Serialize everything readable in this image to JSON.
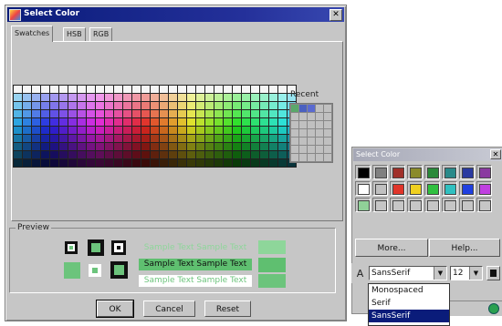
{
  "dialog": {
    "title": "Select Color",
    "close_glyph": "✕",
    "tabs": [
      "Swatches",
      "HSB",
      "RGB"
    ],
    "recent_label": "Recent",
    "recent_colors": [
      "#5aa86a",
      "#4a60c0",
      "#5a6ad0"
    ],
    "preview_label": "Preview",
    "sample_text": "Sample Text  Sample Text",
    "buttons": {
      "ok": "OK",
      "cancel": "Cancel",
      "reset": "Reset"
    }
  },
  "palette": {
    "title": "Select Color",
    "close_glyph": "✕",
    "row1": [
      "#000000",
      "#808080",
      "#a0302a",
      "#8a8a2a",
      "#2a8a3a",
      "#2a8a8a",
      "#2a3aa0",
      "#8a3aa0"
    ],
    "row2": [
      "#ffffff",
      "#c0c0c0",
      "#e0352a",
      "#f0d020",
      "#30c040",
      "#30c0c0",
      "#2040e0",
      "#c040e0"
    ],
    "row3": [
      "#90d098",
      "#c6c6c6",
      "#c6c6c6",
      "#c6c6c6",
      "#c6c6c6",
      "#c6c6c6",
      "#c6c6c6",
      "#c6c6c6"
    ],
    "more_label": "More...",
    "help_label": "Help..."
  },
  "font_bar": {
    "font_icon": "A",
    "font_value": "SansSerif",
    "size_value": "12",
    "font_options": [
      "Monospaced",
      "Serif",
      "SansSerif"
    ],
    "selected_font": "SansSerif"
  },
  "accent_colors": {
    "titlebar": "#0a1c7a",
    "preview_green": "#6cc47c"
  }
}
